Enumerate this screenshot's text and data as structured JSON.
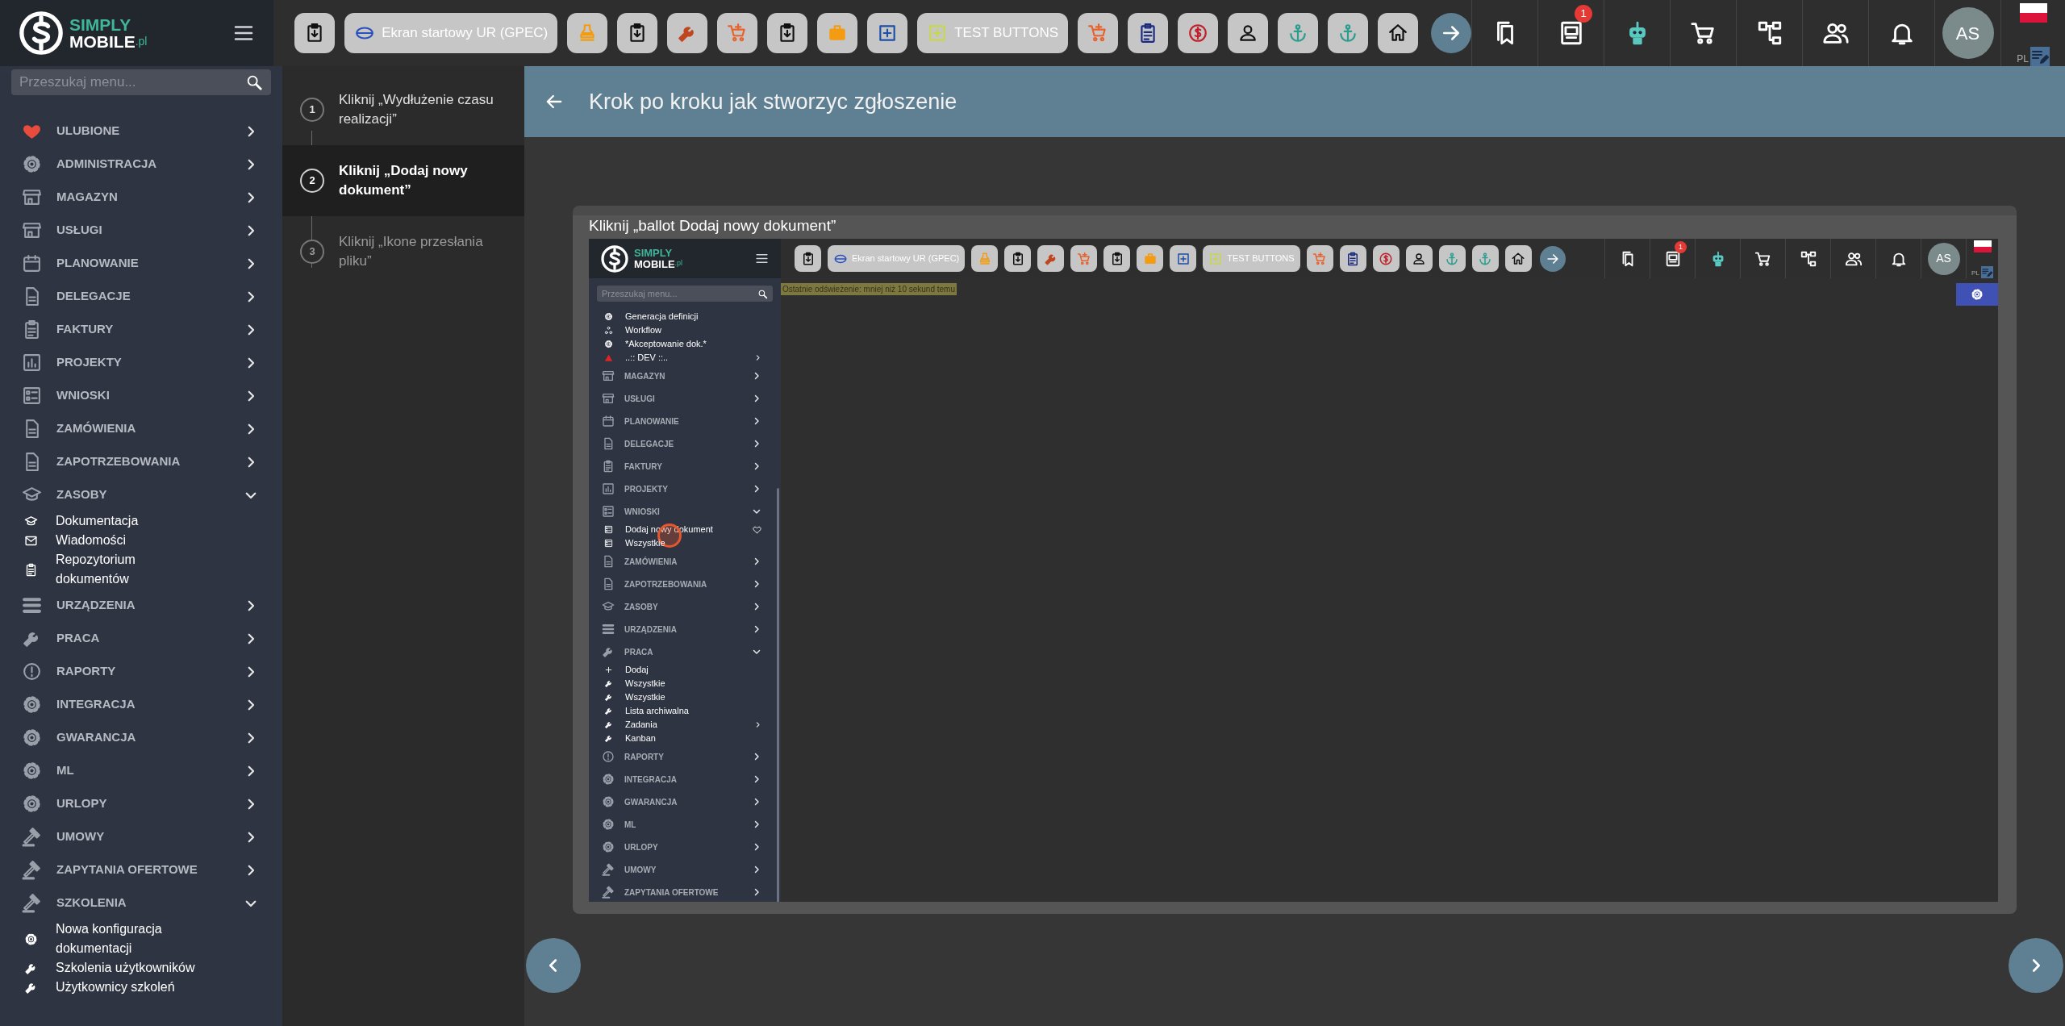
{
  "topbar": {
    "logo": {
      "line1": "SIMPLY",
      "line2": "MOBILE",
      "suffix": ".pl"
    },
    "toolbar": [
      {
        "kind": "icon"
      },
      {
        "kind": "label",
        "label": "Ekran startowy UR (GPEC)"
      },
      {
        "kind": "icon"
      },
      {
        "kind": "icon"
      },
      {
        "kind": "icon"
      },
      {
        "kind": "icon"
      },
      {
        "kind": "icon"
      },
      {
        "kind": "icon"
      },
      {
        "kind": "icon"
      },
      {
        "kind": "label",
        "label": "TEST BUTTONS"
      },
      {
        "kind": "icon"
      },
      {
        "kind": "icon"
      },
      {
        "kind": "icon"
      },
      {
        "kind": "icon"
      },
      {
        "kind": "icon"
      },
      {
        "kind": "icon"
      },
      {
        "kind": "icon"
      }
    ],
    "right_buttons": [
      {
        "kind": "icon"
      },
      {
        "kind": "badged",
        "badge": "1"
      },
      {
        "kind": "icon"
      },
      {
        "kind": "icon"
      },
      {
        "kind": "icon"
      },
      {
        "kind": "icon"
      },
      {
        "kind": "icon"
      }
    ],
    "avatar": "AS",
    "language": "PL"
  },
  "sidebar": {
    "search": {
      "placeholder": "Przeszukaj menu..."
    },
    "items": [
      {
        "label": "ULUBIONE",
        "expanded": false
      },
      {
        "label": "ADMINISTRACJA",
        "expanded": false
      },
      {
        "label": "MAGAZYN",
        "expanded": false
      },
      {
        "label": "USŁUGI",
        "expanded": false
      },
      {
        "label": "PLANOWANIE",
        "expanded": false
      },
      {
        "label": "DELEGACJE",
        "expanded": false
      },
      {
        "label": "FAKTURY",
        "expanded": false
      },
      {
        "label": "PROJEKTY",
        "expanded": false
      },
      {
        "label": "WNIOSKI",
        "expanded": false
      },
      {
        "label": "ZAMÓWIENIA",
        "expanded": false
      },
      {
        "label": "ZAPOTRZEBOWANIA",
        "expanded": false
      },
      {
        "label": "ZASOBY",
        "expanded": true,
        "children": [
          {
            "label": "Dokumentacja"
          },
          {
            "label": "Wiadomości"
          },
          {
            "label": "Repozytorium dokumentów"
          }
        ]
      },
      {
        "label": "URZĄDZENIA",
        "expanded": false
      },
      {
        "label": "PRACA",
        "expanded": false
      },
      {
        "label": "RAPORTY",
        "expanded": false
      },
      {
        "label": "INTEGRACJA",
        "expanded": false
      },
      {
        "label": "GWARANCJA",
        "expanded": false
      },
      {
        "label": "ML",
        "expanded": false
      },
      {
        "label": "URLOPY",
        "expanded": false
      },
      {
        "label": "UMOWY",
        "expanded": false
      },
      {
        "label": "ZAPYTANIA OFERTOWE",
        "expanded": false
      },
      {
        "label": "SZKOLENIA",
        "expanded": true,
        "children": [
          {
            "label": "Nowa konfiguracja dokumentacji"
          },
          {
            "label": "Szkolenia użytkowników"
          },
          {
            "label": "Użytkownicy szkoleń"
          }
        ]
      }
    ]
  },
  "steps": [
    {
      "number": "1",
      "label": "Kliknij „Wydłużenie czasu realizacji”",
      "selected": false
    },
    {
      "number": "2",
      "label": "Kliknij „Dodaj nowy dokument”",
      "selected": true
    },
    {
      "number": "3",
      "label": "Kliknij „Ikone przesłania pliku”",
      "selected": false
    }
  ],
  "header": {
    "title": "Krok po kroku jak stworzyc zgłoszenie"
  },
  "step_card": {
    "caption": "Kliknij „ballot Dodaj nowy dokument”",
    "screenshot": {
      "topbar": {
        "logo": {
          "line1": "SIMPLY",
          "line2": "MOBILE",
          "suffix": ".pl"
        },
        "toolbar": [
          {
            "kind": "icon"
          },
          {
            "kind": "label",
            "label": "Ekran startowy UR (GPEC)"
          },
          {
            "kind": "icon"
          },
          {
            "kind": "icon"
          },
          {
            "kind": "icon"
          },
          {
            "kind": "icon"
          },
          {
            "kind": "icon"
          },
          {
            "kind": "icon"
          },
          {
            "kind": "icon"
          },
          {
            "kind": "label",
            "label": "TEST BUTTONS"
          },
          {
            "kind": "icon"
          },
          {
            "kind": "icon"
          },
          {
            "kind": "icon"
          },
          {
            "kind": "icon"
          },
          {
            "kind": "icon"
          },
          {
            "kind": "icon"
          },
          {
            "kind": "icon"
          }
        ],
        "right_buttons": [
          {
            "kind": "icon"
          },
          {
            "kind": "badged",
            "badge": "1"
          },
          {
            "kind": "icon"
          },
          {
            "kind": "icon"
          },
          {
            "kind": "icon"
          },
          {
            "kind": "icon"
          },
          {
            "kind": "icon"
          }
        ],
        "avatar": "AS",
        "language": "PL"
      },
      "refresh_notice": "Ostatnie odświeżenie: mniej niż 10 sekund temu",
      "sidebar": {
        "search": {
          "placeholder": "Przeszukaj menu..."
        },
        "items": [
          {
            "kind": "link",
            "label": "Generacja definicji",
            "submenu": false
          },
          {
            "kind": "link",
            "label": "Workflow",
            "submenu": false
          },
          {
            "kind": "link",
            "label": "*Akceptowanie dok.*",
            "submenu": false
          },
          {
            "kind": "link",
            "label": "..:: DEV ::..",
            "submenu": true
          },
          {
            "kind": "section",
            "label": "MAGAZYN",
            "expanded": false
          },
          {
            "kind": "section",
            "label": "USŁUGI",
            "expanded": false
          },
          {
            "kind": "section",
            "label": "PLANOWANIE",
            "expanded": false
          },
          {
            "kind": "section",
            "label": "DELEGACJE",
            "expanded": false
          },
          {
            "kind": "section",
            "label": "FAKTURY",
            "expanded": false
          },
          {
            "kind": "section",
            "label": "PROJEKTY",
            "expanded": false
          },
          {
            "kind": "section",
            "label": "WNIOSKI",
            "expanded": true,
            "children": [
              {
                "label": "Dodaj nowy dokument",
                "favorite": true,
                "submenu": false,
                "clicked": true
              },
              {
                "label": "Wszystkie",
                "favorite": false,
                "submenu": false,
                "clicked": false
              }
            ]
          },
          {
            "kind": "section",
            "label": "ZAMÓWIENIA",
            "expanded": false
          },
          {
            "kind": "section",
            "label": "ZAPOTRZEBOWANIA",
            "expanded": false
          },
          {
            "kind": "section",
            "label": "ZASOBY",
            "expanded": false
          },
          {
            "kind": "section",
            "label": "URZĄDZENIA",
            "expanded": false
          },
          {
            "kind": "section",
            "label": "PRACA",
            "expanded": true,
            "children": [
              {
                "label": "Dodaj",
                "favorite": false,
                "submenu": false,
                "clicked": false
              },
              {
                "label": "Wszystkie",
                "favorite": false,
                "submenu": false,
                "clicked": false
              },
              {
                "label": "Wszystkie",
                "favorite": false,
                "submenu": false,
                "clicked": false
              },
              {
                "label": "Lista archiwalna",
                "favorite": false,
                "submenu": false,
                "clicked": false
              },
              {
                "label": "Zadania",
                "favorite": false,
                "submenu": true,
                "clicked": false
              },
              {
                "label": "Kanban",
                "favorite": false,
                "submenu": false,
                "clicked": false
              }
            ]
          },
          {
            "kind": "section",
            "label": "RAPORTY",
            "expanded": false
          },
          {
            "kind": "section",
            "label": "INTEGRACJA",
            "expanded": false
          },
          {
            "kind": "section",
            "label": "GWARANCJA",
            "expanded": false
          },
          {
            "kind": "section",
            "label": "ML",
            "expanded": false
          },
          {
            "kind": "section",
            "label": "URLOPY",
            "expanded": false
          },
          {
            "kind": "section",
            "label": "UMOWY",
            "expanded": false
          },
          {
            "kind": "section",
            "label": "ZAPYTANIA OFERTOWE",
            "expanded": false
          }
        ]
      }
    }
  }
}
